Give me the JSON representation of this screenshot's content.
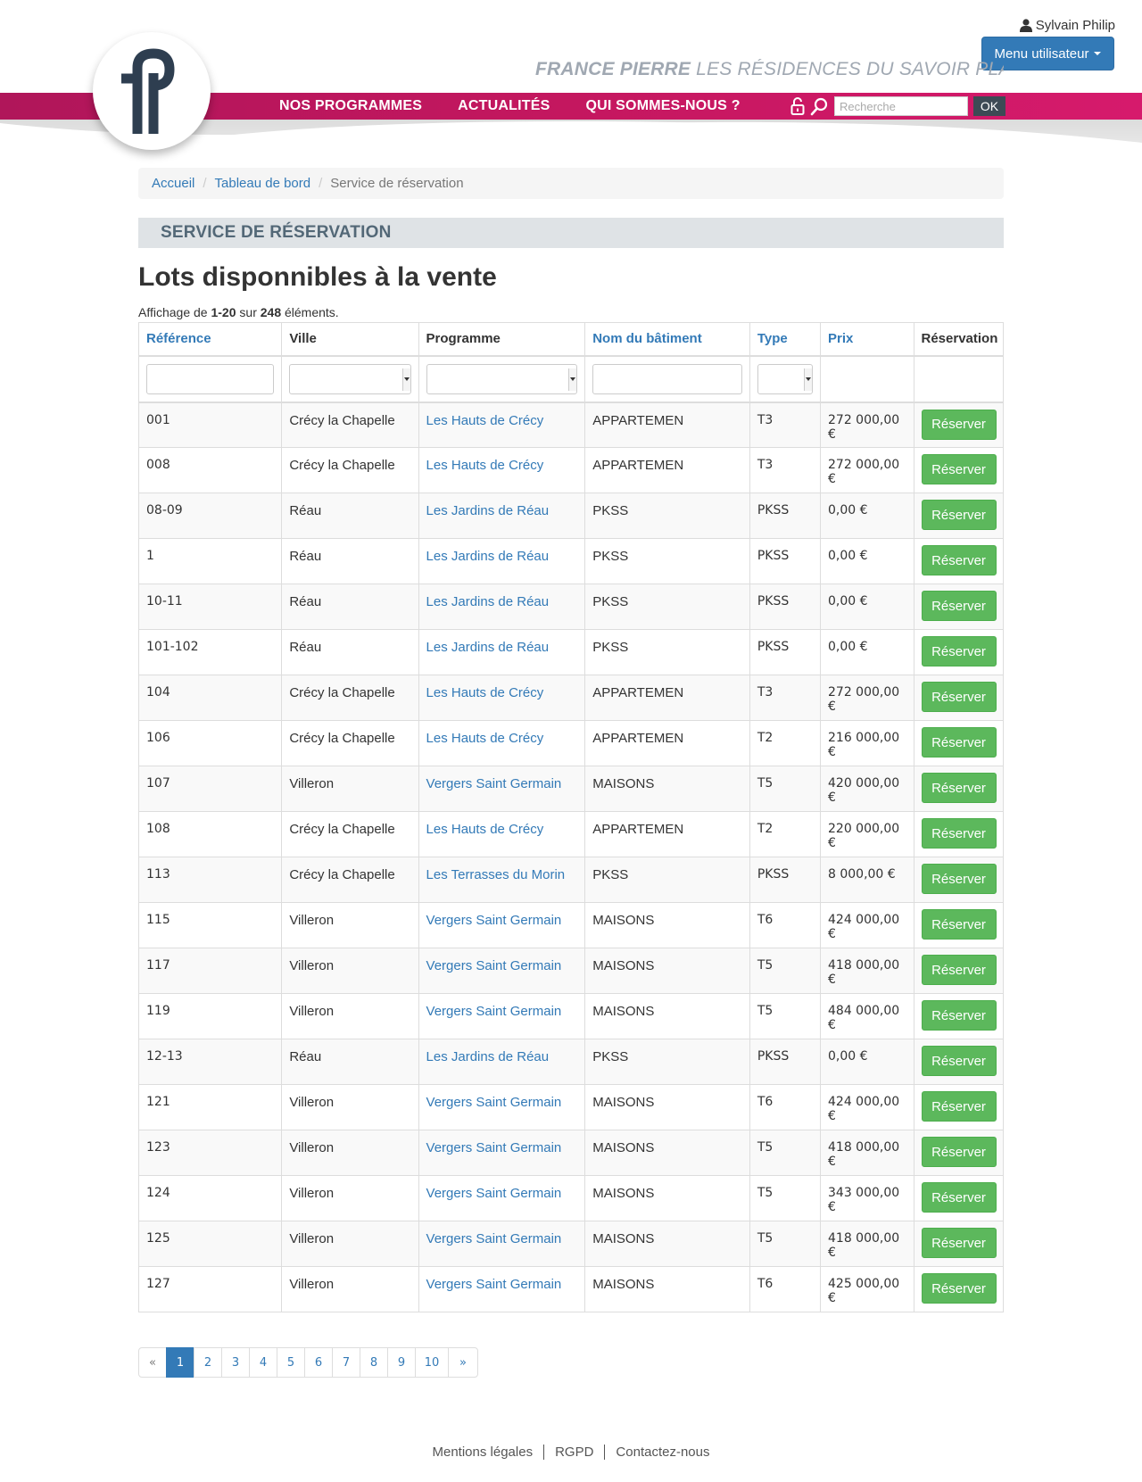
{
  "header": {
    "user_name": "Sylvain Philip",
    "user_menu_label": "Menu utilisateur",
    "tagline_brand": "FRANCE PIERRE",
    "tagline_rest": " LES RÉSIDENCES DU SAVOIR PLAIRE",
    "nav": [
      "NOS PROGRAMMES",
      "ACTUALITÉS",
      "QUI SOMMES-NOUS ?"
    ],
    "search_placeholder": "Recherche",
    "search_button": "OK"
  },
  "breadcrumb": [
    "Accueil",
    "Tableau de bord",
    "Service de réservation"
  ],
  "section_title": "SERVICE DE RÉSERVATION",
  "page_title": "Lots disponnibles à la vente",
  "summary": {
    "prefix": "Affichage de ",
    "range": "1-20",
    "middle": " sur ",
    "total": "248",
    "suffix": " éléments."
  },
  "table": {
    "columns": [
      "Référence",
      "Ville",
      "Programme",
      "Nom du bâtiment",
      "Type",
      "Prix",
      "Réservation"
    ],
    "reserve_label": "Réserver",
    "rows": [
      [
        "001",
        "Crécy la Chapelle",
        "Les Hauts de Crécy",
        "APPARTEMEN",
        "T3",
        "272 000,00 €"
      ],
      [
        "008",
        "Crécy la Chapelle",
        "Les Hauts de Crécy",
        "APPARTEMEN",
        "T3",
        "272 000,00 €"
      ],
      [
        "08-09",
        "Réau",
        "Les Jardins de Réau",
        "PKSS",
        "PKSS",
        "0,00 €"
      ],
      [
        "1",
        "Réau",
        "Les Jardins de Réau",
        "PKSS",
        "PKSS",
        "0,00 €"
      ],
      [
        "10-11",
        "Réau",
        "Les Jardins de Réau",
        "PKSS",
        "PKSS",
        "0,00 €"
      ],
      [
        "101-102",
        "Réau",
        "Les Jardins de Réau",
        "PKSS",
        "PKSS",
        "0,00 €"
      ],
      [
        "104",
        "Crécy la Chapelle",
        "Les Hauts de Crécy",
        "APPARTEMEN",
        "T3",
        "272 000,00 €"
      ],
      [
        "106",
        "Crécy la Chapelle",
        "Les Hauts de Crécy",
        "APPARTEMEN",
        "T2",
        "216 000,00 €"
      ],
      [
        "107",
        "Villeron",
        "Vergers Saint Germain",
        "MAISONS",
        "T5",
        "420 000,00 €"
      ],
      [
        "108",
        "Crécy la Chapelle",
        "Les Hauts de Crécy",
        "APPARTEMEN",
        "T2",
        "220 000,00 €"
      ],
      [
        "113",
        "Crécy la Chapelle",
        "Les Terrasses du Morin",
        "PKSS",
        "PKSS",
        "8 000,00 €"
      ],
      [
        "115",
        "Villeron",
        "Vergers Saint Germain",
        "MAISONS",
        "T6",
        "424 000,00 €"
      ],
      [
        "117",
        "Villeron",
        "Vergers Saint Germain",
        "MAISONS",
        "T5",
        "418 000,00 €"
      ],
      [
        "119",
        "Villeron",
        "Vergers Saint Germain",
        "MAISONS",
        "T5",
        "484 000,00 €"
      ],
      [
        "12-13",
        "Réau",
        "Les Jardins de Réau",
        "PKSS",
        "PKSS",
        "0,00 €"
      ],
      [
        "121",
        "Villeron",
        "Vergers Saint Germain",
        "MAISONS",
        "T6",
        "424 000,00 €"
      ],
      [
        "123",
        "Villeron",
        "Vergers Saint Germain",
        "MAISONS",
        "T5",
        "418 000,00 €"
      ],
      [
        "124",
        "Villeron",
        "Vergers Saint Germain",
        "MAISONS",
        "T5",
        "343 000,00 €"
      ],
      [
        "125",
        "Villeron",
        "Vergers Saint Germain",
        "MAISONS",
        "T5",
        "418 000,00 €"
      ],
      [
        "127",
        "Villeron",
        "Vergers Saint Germain",
        "MAISONS",
        "T6",
        "425 000,00 €"
      ]
    ]
  },
  "pagination": {
    "prev": "«",
    "pages": [
      "1",
      "2",
      "3",
      "4",
      "5",
      "6",
      "7",
      "8",
      "9",
      "10"
    ],
    "next": "»",
    "active": "1"
  },
  "footer": [
    "Mentions légales",
    "RGPD",
    "Contactez-nous"
  ],
  "colors": {
    "magenta": "#c4175f",
    "accent": "#337ab7",
    "success": "#5cb85c",
    "section_bar": "#dfe3e6",
    "logo_navy": "#2e3e50"
  },
  "icons": {
    "user": "user-icon",
    "lock": "lock-icon",
    "search": "search-icon",
    "logo": "france-pierre-logo"
  }
}
